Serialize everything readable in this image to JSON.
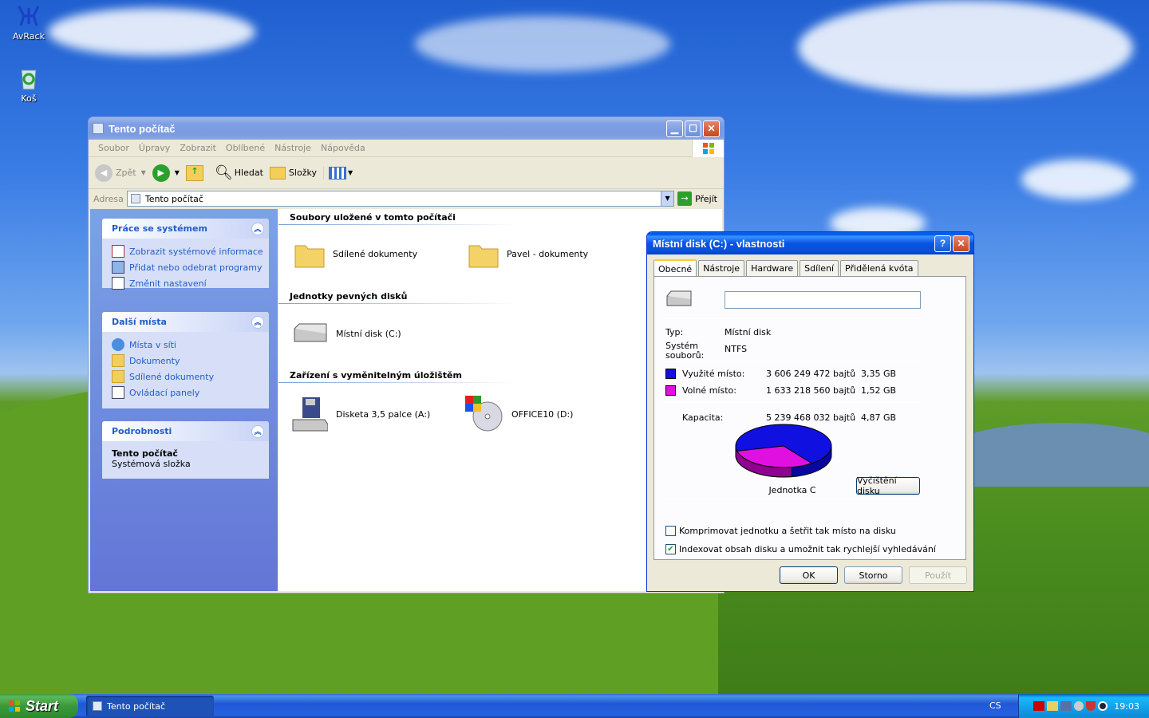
{
  "desktop": {
    "icons": [
      {
        "label": "AvRack",
        "icon": "avrack-icon"
      },
      {
        "label": "Koš",
        "icon": "recycle-bin-icon"
      }
    ]
  },
  "explorer": {
    "title": "Tento počítač",
    "menu": [
      "Soubor",
      "Úpravy",
      "Zobrazit",
      "Oblíbené",
      "Nástroje",
      "Nápověda"
    ],
    "toolbar": {
      "back": "Zpět",
      "search": "Hledat",
      "folders": "Složky"
    },
    "address": {
      "label": "Adresa",
      "value": "Tento počítač",
      "go": "Přejít"
    },
    "sidebar": {
      "system_tasks": {
        "title": "Práce se systémem",
        "items": [
          "Zobrazit systémové informace",
          "Přidat nebo odebrat programy",
          "Změnit nastavení"
        ]
      },
      "other_places": {
        "title": "Další místa",
        "items": [
          "Místa v síti",
          "Dokumenty",
          "Sdílené dokumenty",
          "Ovládací panely"
        ]
      },
      "details": {
        "title": "Podrobnosti",
        "name": "Tento počítač",
        "desc": "Systémová složka"
      }
    },
    "sections": {
      "stored": {
        "title": "Soubory uložené v tomto počítači",
        "items": [
          "Sdílené dokumenty",
          "Pavel - dokumenty"
        ]
      },
      "hdd": {
        "title": "Jednotky pevných disků",
        "items": [
          "Místní disk (C:)"
        ]
      },
      "removable": {
        "title": "Zařízení s vyměnitelným úložištěm",
        "items": [
          "Disketa 3,5 palce (A:)",
          "OFFICE10 (D:)"
        ]
      }
    }
  },
  "dialog": {
    "title": "Místní disk (C:) - vlastnosti",
    "tabs": [
      "Obecné",
      "Nástroje",
      "Hardware",
      "Sdílení",
      "Přidělená kvóta"
    ],
    "name_value": "",
    "type_label": "Typ:",
    "type_value": "Místní disk",
    "fs_label": "Systém souborů:",
    "fs_value": "NTFS",
    "used": {
      "label": "Využité místo:",
      "bytes": "3 606 249 472 bajtů",
      "gb": "3,35 GB",
      "color": "#1010e0"
    },
    "free": {
      "label": "Volné místo:",
      "bytes": "1 633 218 560 bajtů",
      "gb": "1,52 GB",
      "color": "#e010e0"
    },
    "capacity": {
      "label": "Kapacita:",
      "bytes": "5 239 468 032 bajtů",
      "gb": "4,87 GB"
    },
    "used_fraction": 0.688,
    "drive_label": "Jednotka C",
    "cleanup": "Vyčištění disku",
    "compress": {
      "label": "Komprimovat jednotku a šetřit tak místo na disku",
      "checked": false
    },
    "index": {
      "label": "Indexovat obsah disku a umožnit tak rychlejší vyhledávání",
      "checked": true
    },
    "buttons": {
      "ok": "OK",
      "cancel": "Storno",
      "apply": "Použít"
    }
  },
  "taskbar": {
    "start": "Start",
    "task": "Tento počítač",
    "lang": "CS",
    "clock": "19:03"
  }
}
